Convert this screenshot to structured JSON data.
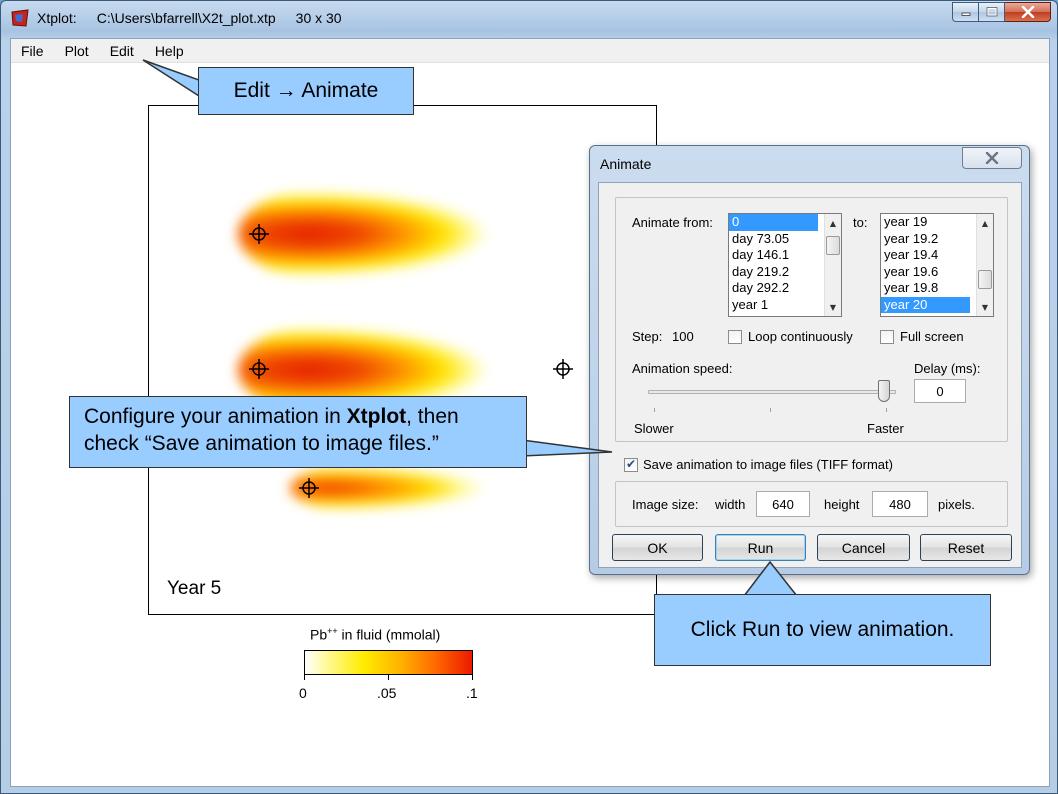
{
  "window": {
    "app_name": "Xtplot:",
    "file_path": "C:\\Users\\bfarrell\\X2t_plot.xtp",
    "grid_size": "30 x 30"
  },
  "menu": [
    {
      "label": "File"
    },
    {
      "label": "Plot"
    },
    {
      "label": "Edit"
    },
    {
      "label": "Help"
    }
  ],
  "plot": {
    "time_label": "Year 5",
    "legend": {
      "title_prefix": "Pb",
      "title_sup": "++",
      "title_suffix": " in fluid (mmolal)",
      "ticks": [
        "0",
        ".05",
        ".1"
      ]
    }
  },
  "callouts": {
    "edit_animate": "Edit → Animate",
    "configure_prefix": "Configure your animation in ",
    "configure_bold": "Xtplot",
    "configure_suffix": ", then check “Save animation to image files.”",
    "click_run": "Click Run to view animation."
  },
  "dialog": {
    "title": "Animate",
    "animate_from_label": "Animate from:",
    "from_items": [
      "0",
      "day 73.05",
      "day 146.1",
      "day 219.2",
      "day 292.2",
      "year 1"
    ],
    "from_selected": 0,
    "to_label": "to:",
    "to_items": [
      "year 19",
      "year 19.2",
      "year 19.4",
      "year 19.6",
      "year 19.8",
      "year 20"
    ],
    "to_selected": 5,
    "step_label": "Step:",
    "step_value": "100",
    "loop_label": "Loop continuously",
    "loop_checked": false,
    "fullscreen_label": "Full screen",
    "fullscreen_checked": false,
    "speed_label": "Animation speed:",
    "speed_level": 1.0,
    "delay_label": "Delay (ms):",
    "delay_value": "0",
    "slower_label": "Slower",
    "faster_label": "Faster",
    "save_label": "Save animation to image files (TIFF format)",
    "save_checked": true,
    "image_size_label": "Image size:",
    "width_label": "width",
    "width_value": "640",
    "height_label": "height",
    "height_value": "480",
    "pixels_label": "pixels.",
    "buttons": {
      "ok": "OK",
      "run": "Run",
      "cancel": "Cancel",
      "reset": "Reset"
    }
  }
}
